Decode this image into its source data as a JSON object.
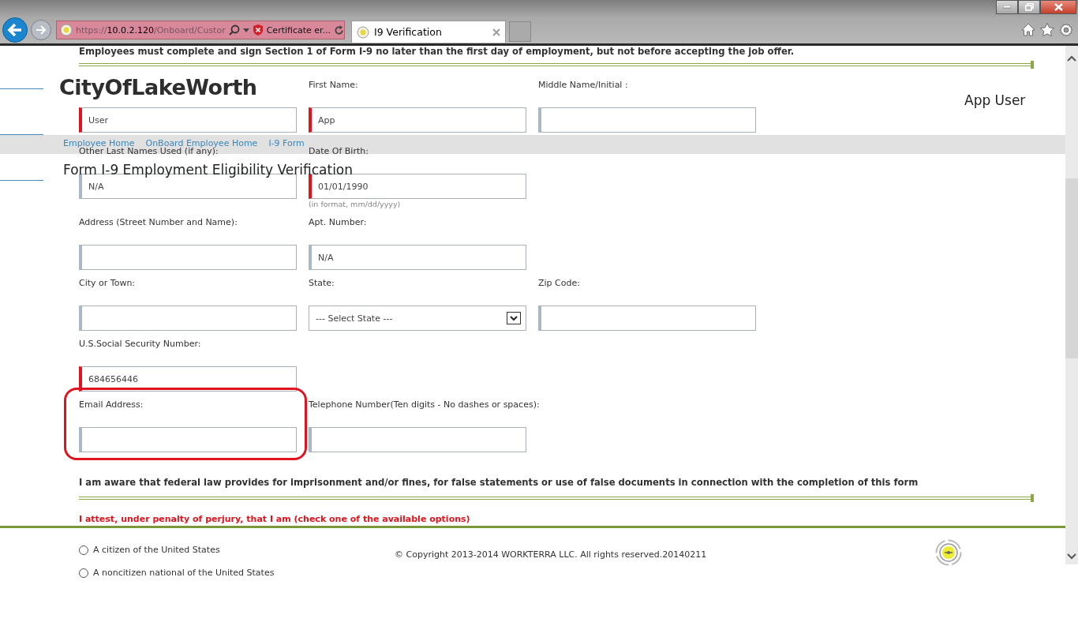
{
  "browser": {
    "address": {
      "scheme": "https://",
      "host": "10.0.2.120",
      "path": "/Onboard/Custor"
    },
    "certificate_error": "Certificate er...",
    "tabs": [
      {
        "title": "I9 Verification",
        "selected": true
      }
    ]
  },
  "header": {
    "company": "CityOfLakeWorth",
    "user": "App User",
    "breadcrumbs": [
      "Employee Home",
      "OnBoard Employee Home",
      "I-9 Form"
    ],
    "page_title": "Form I-9 Employment Eligibility Verification"
  },
  "form": {
    "intro": "Employees must complete and sign Section 1 of Form I-9 no later than the first day of employment, but not before accepting the job offer.",
    "rows": [
      {
        "fields": [
          {
            "kind": "text",
            "value": "User",
            "required": true
          },
          {
            "kind": "text",
            "label": "First Name:",
            "value": "App",
            "required": true
          },
          {
            "kind": "text",
            "label": "Middle Name/Initial :",
            "required": false
          }
        ]
      },
      {
        "fields": [
          {
            "kind": "text",
            "label": "Other Last Names Used (if any):",
            "value": "N/A",
            "required": false
          },
          {
            "kind": "text",
            "label": "Date Of Birth:",
            "value": "01/01/1990",
            "required": true,
            "hint": "(in format, mm/dd/yyyy)"
          }
        ]
      },
      {
        "fields": [
          {
            "kind": "text",
            "label": "Address (Street Number and Name):",
            "required": false
          },
          {
            "kind": "text",
            "label": "Apt. Number:",
            "value": "N/A",
            "required": false
          }
        ]
      },
      {
        "fields": [
          {
            "kind": "text",
            "label": "City or Town:",
            "required": false
          },
          {
            "kind": "select",
            "label": "State:",
            "value": "--- Select State ---",
            "required": false
          },
          {
            "kind": "text",
            "label": "Zip Code:",
            "required": false
          }
        ]
      },
      {
        "fields": [
          {
            "kind": "text",
            "label": "U.S.Social Security Number:",
            "value": "684656446",
            "required": true
          }
        ]
      },
      {
        "fields": [
          {
            "kind": "text",
            "label": "Email Address:",
            "required": false,
            "highlighted": true
          },
          {
            "kind": "text",
            "label": "Telephone Number(Ten digits - No dashes or spaces):",
            "required": false
          }
        ]
      }
    ],
    "statement": "I am aware that federal law provides for imprisonment and/or fines, for false statements or use of false documents in connection with the completion of this form",
    "attestation": "I attest, under penalty of perjury, that I am (check one of the available options)",
    "options": [
      {
        "label": "A citizen of the United States",
        "selected": false
      },
      {
        "label": "A noncitizen national of the United States",
        "selected": false
      }
    ]
  },
  "footer": {
    "copyright": "© Copyright 2013-2014 WORKTERRA LLC. All rights reserved.20140211"
  }
}
